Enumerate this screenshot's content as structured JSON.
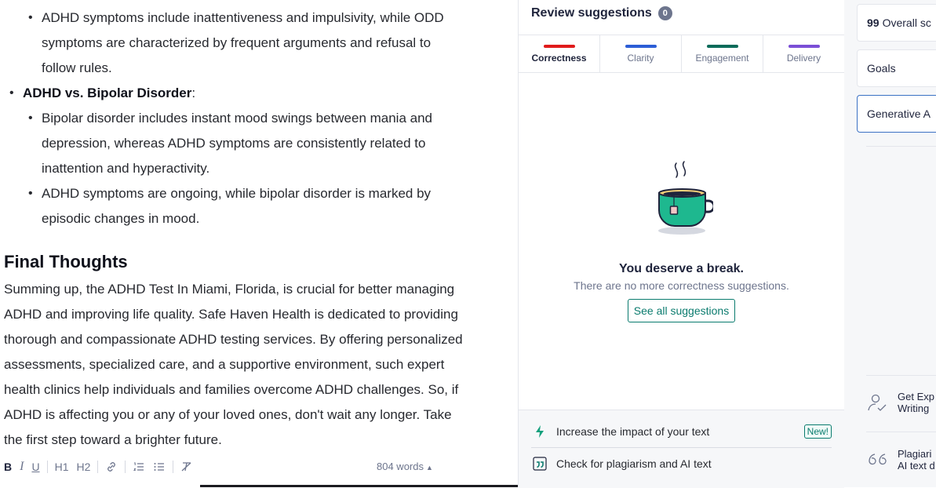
{
  "editor": {
    "list1": [
      "ADHD symptoms include inattentiveness and impulsivity, while ODD symptoms are characterized by frequent arguments and refusal to follow rules."
    ],
    "bipolar": {
      "label_bold": "ADHD vs. Bipolar Disorder",
      "label_suffix": ":",
      "items": [
        "Bipolar disorder includes instant mood swings between mania and depression, whereas ADHD symptoms are consistently related to inattention and hyperactivity.",
        "ADHD symptoms are ongoing, while bipolar disorder is marked by episodic changes in mood."
      ]
    },
    "heading": "Final Thoughts",
    "paragraph": "Summing up, the ADHD Test In Miami, Florida, is crucial for better managing ADHD and improving life quality. Safe Haven Health is dedicated to providing thorough and compassionate ADHD testing services. By offering personalized assessments, specialized care, and a supportive environment, such expert health clinics help individuals and families overcome ADHD challenges. So, if ADHD is affecting you or any of your loved ones, don't wait any longer. Take the first step toward a brighter future."
  },
  "toolbar": {
    "bold": "B",
    "italic": "I",
    "underline": "U",
    "h1": "H1",
    "h2": "H2",
    "word_count": "804 words"
  },
  "review": {
    "title": "Review suggestions",
    "count": "0",
    "tabs": [
      {
        "label": "Correctness",
        "color": "#e01b1b"
      },
      {
        "label": "Clarity",
        "color": "#2c5ed6"
      },
      {
        "label": "Engagement",
        "color": "#0b6b5a"
      },
      {
        "label": "Delivery",
        "color": "#7b4fd6"
      }
    ],
    "break_title": "You deserve a break.",
    "break_subtitle": "There are no more correctness suggestions.",
    "see_all": "See all suggestions",
    "footer": {
      "impact": "Increase the impact of your text",
      "new_badge": "New!",
      "plagiarism": "Check for plagiarism and AI text"
    }
  },
  "sidebar": {
    "score_number": "99",
    "score_label": "Overall sc",
    "goals": "Goals",
    "generative": "Generative A",
    "expert_line1": "Get Exp",
    "expert_line2": "Writing",
    "plag_line1": "Plagiari",
    "plag_line2": "AI text d"
  }
}
